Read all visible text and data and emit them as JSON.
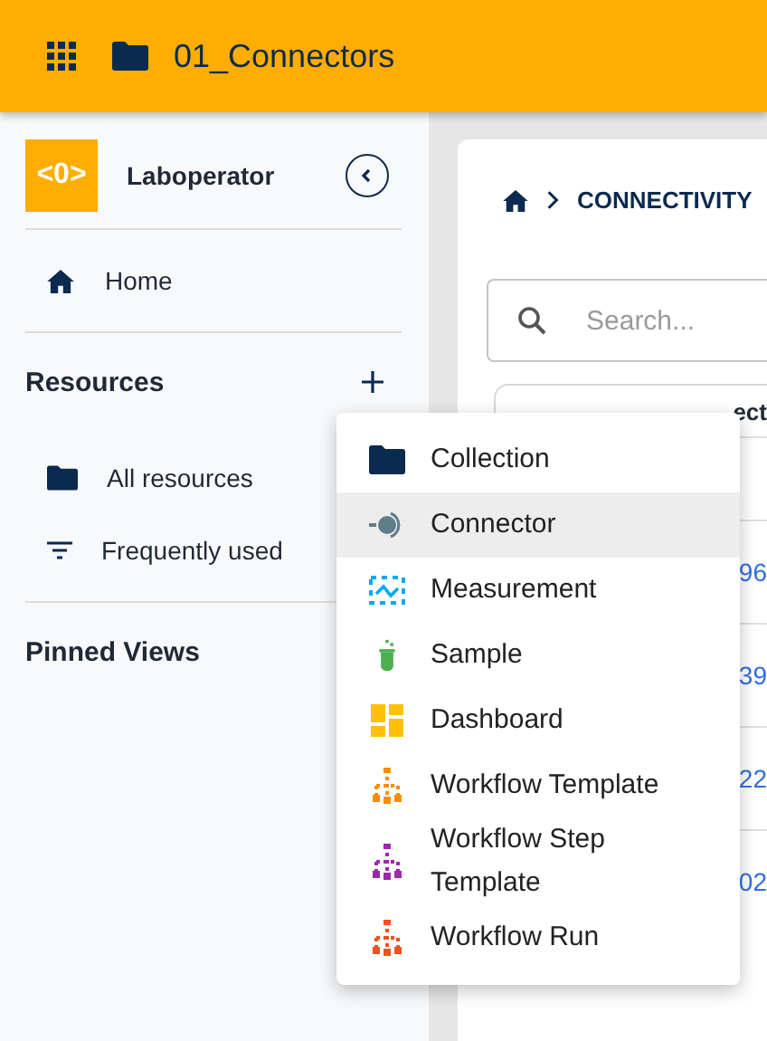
{
  "top_bar": {
    "title": "01_Connectors"
  },
  "sidebar": {
    "org_name": "Laboperator",
    "logo_text": "<0>",
    "items": [
      {
        "label": "Home",
        "kind": "home"
      }
    ],
    "resources": {
      "title": "Resources",
      "items": [
        {
          "label": "All resources",
          "kind": "folder"
        },
        {
          "label": "Frequently used",
          "kind": "filter"
        }
      ]
    },
    "pinned": {
      "title": "Pinned Views"
    }
  },
  "main": {
    "breadcrumb": [
      "CONNECTIVITY"
    ],
    "search": {
      "placeholder": "Search..."
    },
    "filter_fragment": "ect",
    "row_links": [
      "96",
      "39",
      "22",
      "02"
    ]
  },
  "add_menu": {
    "items": [
      {
        "label": "Collection",
        "kind": "collection",
        "selected": false
      },
      {
        "label": "Connector",
        "kind": "connector",
        "selected": true
      },
      {
        "label": "Measurement",
        "kind": "measurement",
        "selected": false
      },
      {
        "label": "Sample",
        "kind": "sample",
        "selected": false
      },
      {
        "label": "Dashboard",
        "kind": "dashboard",
        "selected": false
      },
      {
        "label": "Workflow Template",
        "kind": "workflow",
        "color": "#fb8c00",
        "selected": false
      },
      {
        "label": "Workflow Step Template",
        "kind": "workflow",
        "color": "#9c27b0",
        "selected": false
      },
      {
        "label": "Workflow Run",
        "kind": "workflow",
        "color": "#f4511e",
        "selected": false
      }
    ]
  }
}
